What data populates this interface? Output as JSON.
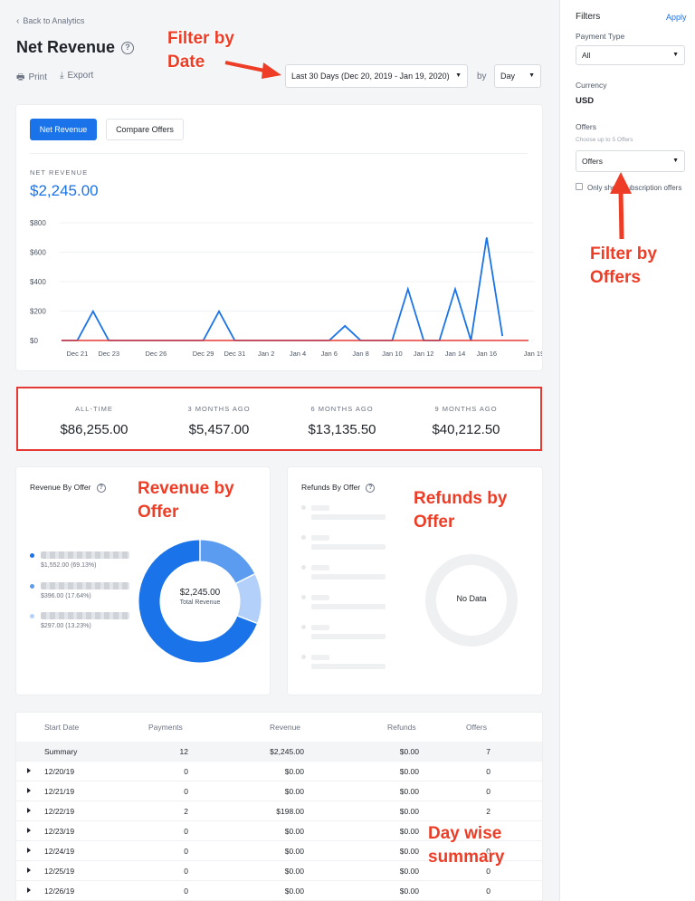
{
  "header": {
    "back_label": "Back to Analytics",
    "title": "Net Revenue",
    "print_label": "Print",
    "export_label": "Export",
    "date_range": "Last 30 Days (Dec 20, 2019  -  Jan 19, 2020)",
    "by_label": "by",
    "granularity": "Day"
  },
  "chart_card": {
    "tab_primary": "Net Revenue",
    "tab_secondary": "Compare Offers",
    "metric_label": "NET REVENUE",
    "metric_value": "$2,245.00"
  },
  "chart_data": {
    "type": "line",
    "title": "",
    "xlabel": "",
    "ylabel": "",
    "ylim": [
      0,
      800
    ],
    "yticks": [
      "$0",
      "$200",
      "$400",
      "$600",
      "$800"
    ],
    "x_tick_labels": [
      "Dec 21",
      "Dec 23",
      "Dec 26",
      "Dec 29",
      "Dec 31",
      "Jan 2",
      "Jan 4",
      "Jan 6",
      "Jan 8",
      "Jan 10",
      "Jan 12",
      "Jan 14",
      "Jan 16",
      "Jan 19"
    ],
    "x": [
      "Dec 20",
      "Dec 21",
      "Dec 22",
      "Dec 23",
      "Dec 24",
      "Dec 25",
      "Dec 26",
      "Dec 27",
      "Dec 28",
      "Dec 29",
      "Dec 30",
      "Dec 31",
      "Jan 1",
      "Jan 2",
      "Jan 3",
      "Jan 4",
      "Jan 5",
      "Jan 6",
      "Jan 7",
      "Jan 8",
      "Jan 9",
      "Jan 10",
      "Jan 11",
      "Jan 12",
      "Jan 13",
      "Jan 14",
      "Jan 15",
      "Jan 16"
    ],
    "series": [
      {
        "color": "#1a73e8",
        "values": [
          0,
          0,
          198,
          0,
          0,
          0,
          0,
          0,
          0,
          0,
          198,
          0,
          0,
          0,
          0,
          0,
          0,
          0,
          99,
          0,
          0,
          0,
          349,
          0,
          0,
          349,
          0,
          700,
          30
        ]
      },
      {
        "color": "#e53935",
        "values": [
          0,
          0,
          0,
          0,
          0,
          0,
          0,
          0,
          0,
          0,
          0,
          0,
          0,
          0,
          0,
          0,
          0,
          0,
          0,
          0,
          0,
          0,
          0,
          0,
          0,
          0,
          0,
          0,
          0
        ]
      }
    ],
    "grid": true
  },
  "stats": [
    {
      "label": "ALL-TIME",
      "value": "$86,255.00"
    },
    {
      "label": "3 MONTHS AGO",
      "value": "$5,457.00"
    },
    {
      "label": "6 MONTHS AGO",
      "value": "$13,135.50"
    },
    {
      "label": "9 MONTHS AGO",
      "value": "$40,212.50"
    }
  ],
  "revenue_by_offer": {
    "title": "Revenue By Offer",
    "center_value": "$2,245.00",
    "center_label": "Total Revenue",
    "items": [
      {
        "amount": "$1,552.00 (69.13%)",
        "share": 69.13,
        "color": "#1a73e8"
      },
      {
        "amount": "$396.00 (17.64%)",
        "share": 17.64,
        "color": "#5b9bf0"
      },
      {
        "amount": "$297.00 (13.23%)",
        "share": 13.23,
        "color": "#b3d0fa"
      }
    ]
  },
  "refunds_by_offer": {
    "title": "Refunds By Offer",
    "empty_label": "No Data"
  },
  "table": {
    "headers": [
      "Start Date",
      "Payments",
      "Revenue",
      "Refunds",
      "Offers"
    ],
    "summary": {
      "label": "Summary",
      "payments": "12",
      "revenue": "$2,245.00",
      "refunds": "$0.00",
      "offers": "7"
    },
    "rows": [
      {
        "date": "12/20/19",
        "payments": "0",
        "revenue": "$0.00",
        "refunds": "$0.00",
        "offers": "0"
      },
      {
        "date": "12/21/19",
        "payments": "0",
        "revenue": "$0.00",
        "refunds": "$0.00",
        "offers": "0"
      },
      {
        "date": "12/22/19",
        "payments": "2",
        "revenue": "$198.00",
        "refunds": "$0.00",
        "offers": "2"
      },
      {
        "date": "12/23/19",
        "payments": "0",
        "revenue": "$0.00",
        "refunds": "$0.00",
        "offers": "0"
      },
      {
        "date": "12/24/19",
        "payments": "0",
        "revenue": "$0.00",
        "refunds": "$0.00",
        "offers": "0"
      },
      {
        "date": "12/25/19",
        "payments": "0",
        "revenue": "$0.00",
        "refunds": "$0.00",
        "offers": "0"
      },
      {
        "date": "12/26/19",
        "payments": "0",
        "revenue": "$0.00",
        "refunds": "$0.00",
        "offers": "0"
      }
    ]
  },
  "sidebar": {
    "title": "Filters",
    "apply_label": "Apply",
    "payment_type_label": "Payment Type",
    "payment_type_value": "All",
    "currency_label": "Currency",
    "currency_value": "USD",
    "offers_label": "Offers",
    "offers_hint": "Choose up to 5 Offers",
    "offers_value": "Offers",
    "checkbox_label": "Only show subscription offers"
  },
  "annotations": {
    "date": "Filter by\nDate",
    "offers": "Filter by\nOffers",
    "revenue": "Revenue by\nOffer",
    "refunds": "Refunds by\nOffer",
    "summary": "Day wise\nsummary"
  },
  "colors": {
    "accent": "#1a73e8",
    "annotation": "#ee3d27"
  }
}
